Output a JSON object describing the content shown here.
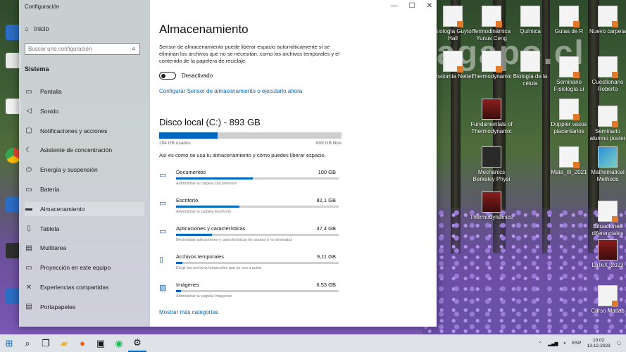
{
  "window": {
    "title": "Configuración",
    "nav": {
      "home": "Inicio",
      "search_placeholder": "Buscar una configuración",
      "section": "Sistema",
      "items": [
        {
          "label": "Pantalla",
          "icon": "monitor-icon"
        },
        {
          "label": "Sonido",
          "icon": "speaker-icon"
        },
        {
          "label": "Notificaciones y acciones",
          "icon": "notification-icon"
        },
        {
          "label": "Asistente de concentración",
          "icon": "moon-icon"
        },
        {
          "label": "Energía y suspensión",
          "icon": "power-icon"
        },
        {
          "label": "Batería",
          "icon": "battery-icon"
        },
        {
          "label": "Almacenamiento",
          "icon": "storage-icon"
        },
        {
          "label": "Tableta",
          "icon": "tablet-icon"
        },
        {
          "label": "Multitarea",
          "icon": "multitask-icon"
        },
        {
          "label": "Proyección en este equipo",
          "icon": "projection-icon"
        },
        {
          "label": "Experiencias compartidas",
          "icon": "shared-icon"
        },
        {
          "label": "Portapapeles",
          "icon": "clipboard-icon"
        }
      ]
    },
    "main": {
      "title": "Almacenamiento",
      "description": "Sensor de almacenamiento puede liberar espacio automáticamente si se eliminan los archivos que no se necesitan, como los archivos temporales y el contenido de la papelera de reciclaje.",
      "toggle_label": "Desactivado",
      "configure_link": "Configurar Sensor de almacenamiento o ejecutarlo ahora",
      "disk_title": "Disco local (C:) - 893 GB",
      "disk_used_fraction": 0.32,
      "used_label": "284 GB usados",
      "free_label": "609 GB libre",
      "intro": "Así es como se usa tu almacenamiento y cómo puedes liberar espacio.",
      "categories": [
        {
          "name": "Documentos",
          "size": "100 GB",
          "sub": "Administrar la carpeta Documentos",
          "fraction": 0.47,
          "icon": "folder-icon"
        },
        {
          "name": "Escritorio",
          "size": "82,1 GB",
          "sub": "Administrar la carpeta Escritorio",
          "fraction": 0.39,
          "icon": "desktop-icon"
        },
        {
          "name": "Aplicaciones y características",
          "size": "47,4 GB",
          "sub": "Desinstalar aplicaciones y características no usadas o no deseadas",
          "fraction": 0.22,
          "icon": "apps-icon"
        },
        {
          "name": "Archivos temporales",
          "size": "9,11 GB",
          "sub": "Elegir los archivos temporales que se van a quitar",
          "fraction": 0.04,
          "icon": "trash-icon"
        },
        {
          "name": "Imágenes",
          "size": "6,53 GB",
          "sub": "Administrar la carpeta Imágenes",
          "fraction": 0.03,
          "icon": "image-icon"
        }
      ],
      "more_link": "Mostrar más categorías"
    }
  },
  "desktop": {
    "watermark": "agapo.cl",
    "icons": [
      {
        "label": "Fisiología Guyton Hall",
        "style": "pdf"
      },
      {
        "label": "Termodinámica Yunus Ceng",
        "style": "pdf"
      },
      {
        "label": "Química",
        "style": "plain"
      },
      {
        "label": "Guías de R",
        "style": "pdf"
      },
      {
        "label": "Nuevo carpeta",
        "style": "pdf"
      },
      {
        "label": "Anatomía Netter",
        "style": "pdf"
      },
      {
        "label": "Thermodynamic",
        "style": "pdf"
      },
      {
        "label": "Biología de la célula",
        "style": "plain"
      },
      {
        "label": "Seminario Fisiología ui",
        "style": "pdf"
      },
      {
        "label": "Cuestionario Roberto",
        "style": "pdf"
      },
      {
        "label": "Fundamentals of Thermodynamic",
        "style": "book"
      },
      {
        "label": "Doppler vasos placentarios",
        "style": "pdf"
      },
      {
        "label": "Seminario alumno poster",
        "style": "pdf"
      },
      {
        "label": "Mechanics Berkeley Physi",
        "style": "dark"
      },
      {
        "label": "Mate_III_2021",
        "style": "pdf"
      },
      {
        "label": "Mathematical Methods",
        "style": "gfx"
      },
      {
        "label": "Thermodynamics",
        "style": "book"
      },
      {
        "label": "Ecuaciones diferenciales",
        "style": "pdf"
      },
      {
        "label": "LaTeX_2023",
        "style": "book"
      },
      {
        "label": "Curso Matlab",
        "style": "pdf"
      }
    ]
  },
  "taskbar": {
    "items": [
      "windows-icon",
      "search-icon",
      "taskview-icon",
      "explorer-icon",
      "firefox-icon",
      "terminal-icon",
      "spotify-icon",
      "settings-icon"
    ],
    "language": "ESP",
    "time": "10:02",
    "date": "13-12-2023"
  }
}
